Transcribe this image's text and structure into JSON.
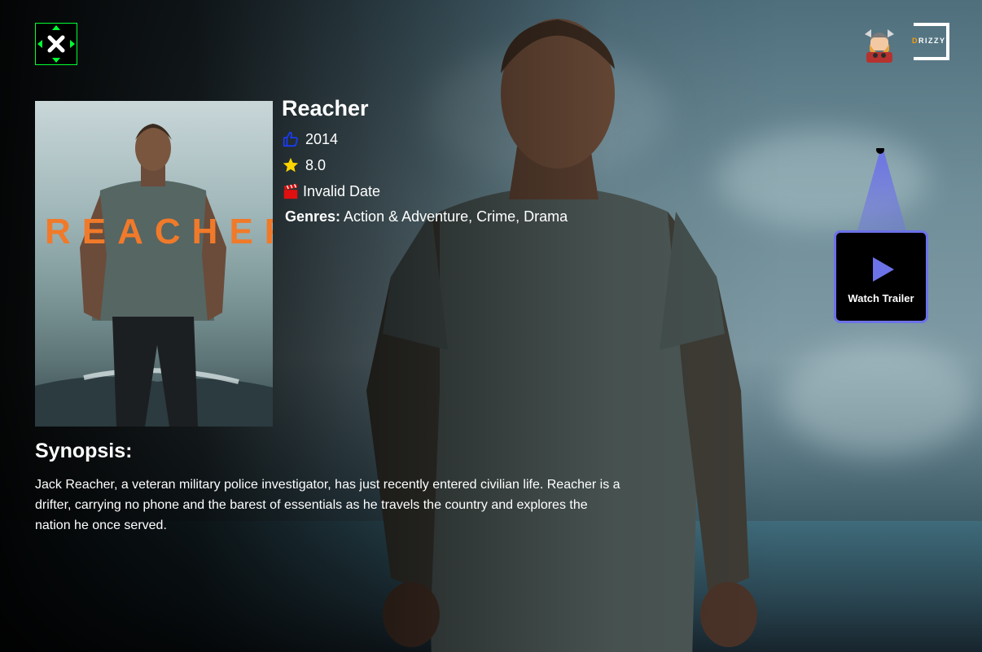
{
  "header": {
    "logo_icon": "close-x-logo",
    "avatar_icon": "viking-avatar-icon",
    "brand_text_pre": "",
    "brand_text_accent": "D",
    "brand_text_rest": "RIZZY"
  },
  "show": {
    "title": "Reacher",
    "poster_title": "REACHER",
    "year": "2014",
    "rating": "8.0",
    "release": "Invalid Date",
    "genres_label": "Genres:",
    "genres": "Action & Adventure, Crime, Drama"
  },
  "trailer": {
    "label": "Watch Trailer",
    "accent": "#6c72e8"
  },
  "synopsis": {
    "heading": "Synopsis:",
    "text": "Jack Reacher, a veteran military police investigator, has just recently entered civilian life. Reacher is a drifter, carrying no phone and the barest of essentials as he travels the country and explores the nation he once served."
  },
  "icons": {
    "year": "thumbs-up-icon",
    "rating": "star-icon",
    "release": "clapperboard-icon"
  }
}
